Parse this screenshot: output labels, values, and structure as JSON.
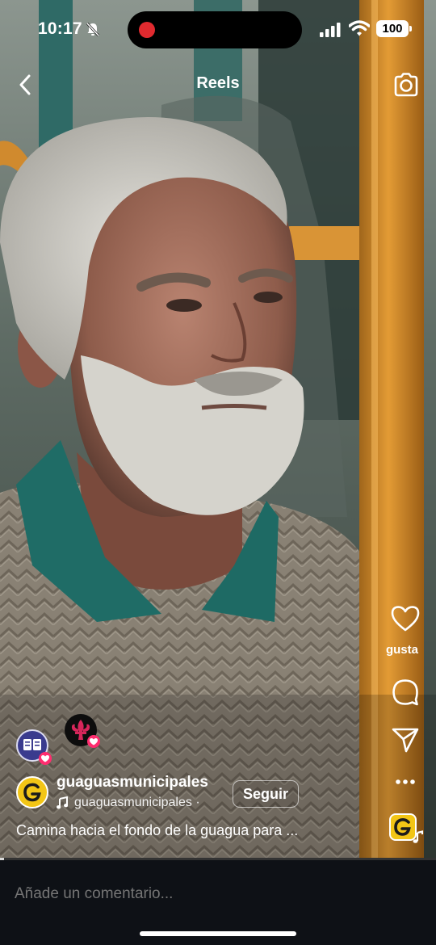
{
  "status_bar": {
    "time": "10:17",
    "battery": "100",
    "icons": [
      "bell-slash-icon",
      "recording-dot",
      "cellular-signal-icon",
      "wifi-icon",
      "battery-icon"
    ]
  },
  "header": {
    "title": "Reels",
    "back_icon": "chevron-left-icon",
    "camera_icon": "camera-icon"
  },
  "actions": {
    "like_label": "gusta",
    "icons": [
      "heart-icon",
      "comment-icon",
      "share-icon",
      "more-icon",
      "audio-icon"
    ]
  },
  "post": {
    "username": "guaguasmunicipales",
    "audio_label": "guaguasmunicipales ·",
    "follow_label": "Seguir",
    "caption": "Camina hacia el fondo de la guagua para ..."
  },
  "comment_bar": {
    "placeholder": "Añade un comentario..."
  },
  "progress": {
    "fraction": 0.01
  },
  "colors": {
    "accent_yellow": "#f2c516",
    "recording_red": "#e02a2f",
    "reaction_heart": "#ff2d6f",
    "comment_bar_bg": "#0e1116"
  }
}
